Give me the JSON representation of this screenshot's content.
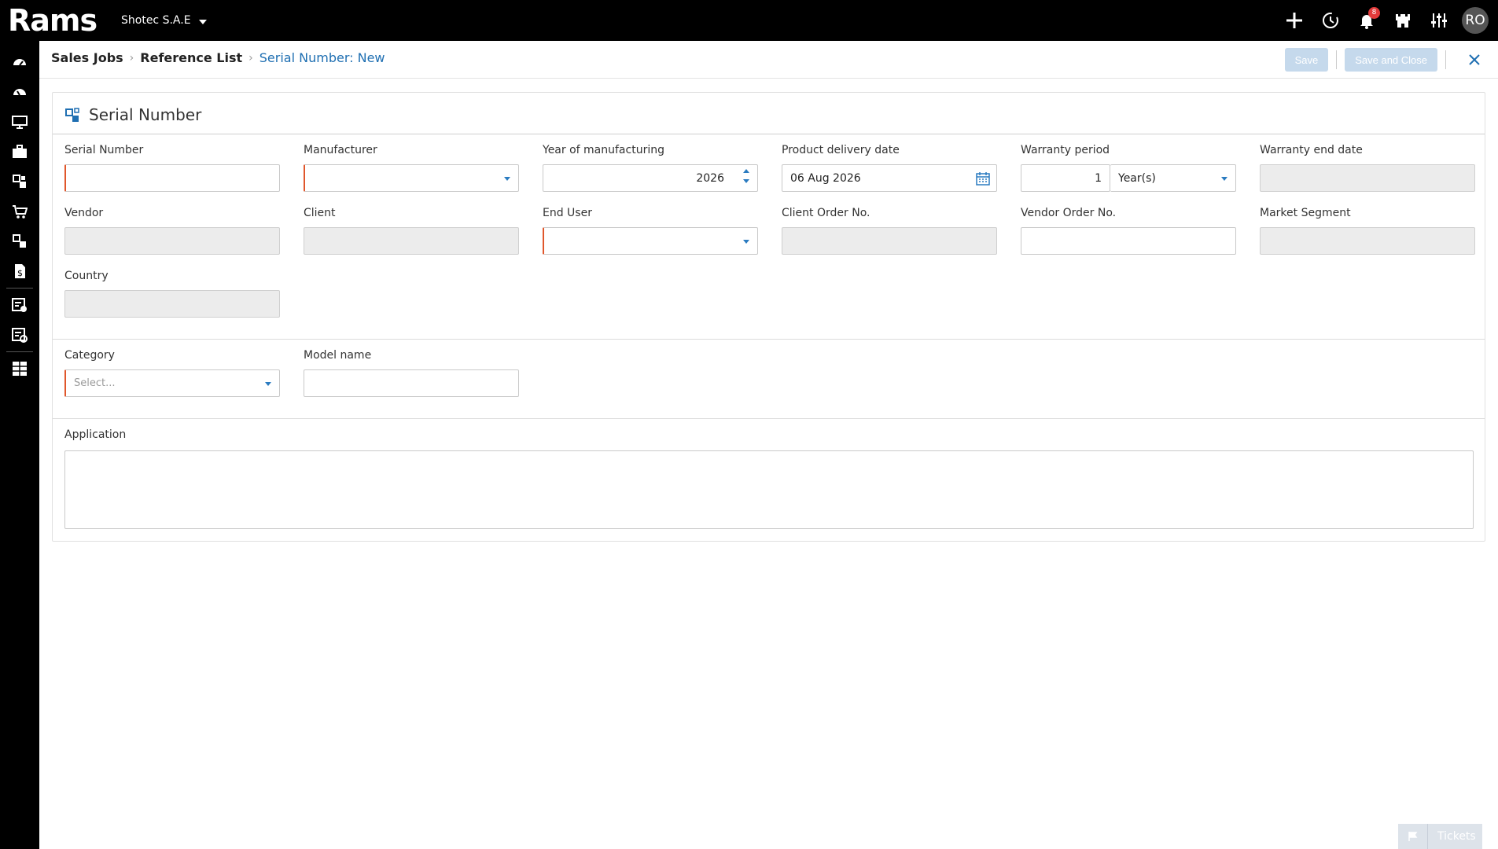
{
  "topbar": {
    "logo_text": "Rams",
    "company": "Shotec S.A.E",
    "notification_count": "8",
    "avatar": "RO",
    "icons": [
      "plus-icon",
      "history-icon",
      "bell-icon",
      "castle-icon",
      "sliders-icon"
    ]
  },
  "sidebar": {
    "items": [
      "dashboard-icon",
      "dashboard-alt-icon",
      "monitor-icon",
      "briefcase-icon",
      "serial-icon",
      "cart-icon",
      "module-icon",
      "invoice-icon",
      "checklist-icon",
      "settings-doc-icon",
      "grid-icon"
    ]
  },
  "breadcrumb": {
    "items": [
      "Sales Jobs",
      "Reference List"
    ],
    "current": "Serial Number: New"
  },
  "actions": {
    "save": "Save",
    "save_close": "Save and Close"
  },
  "form": {
    "title": "Serial Number",
    "fields": {
      "serial_number": {
        "label": "Serial Number",
        "value": ""
      },
      "manufacturer": {
        "label": "Manufacturer",
        "value": ""
      },
      "year": {
        "label": "Year of manufacturing",
        "value": "2026"
      },
      "delivery": {
        "label": "Product delivery date",
        "value": "06 Aug 2026"
      },
      "warranty": {
        "label": "Warranty period",
        "value": "1",
        "unit": "Year(s)"
      },
      "warranty_end": {
        "label": "Warranty end date",
        "value": ""
      },
      "vendor": {
        "label": "Vendor",
        "value": ""
      },
      "client": {
        "label": "Client",
        "value": ""
      },
      "end_user": {
        "label": "End User",
        "value": ""
      },
      "client_order": {
        "label": "Client Order No.",
        "value": ""
      },
      "vendor_order": {
        "label": "Vendor Order No.",
        "value": ""
      },
      "market_segment": {
        "label": "Market Segment",
        "value": ""
      },
      "country": {
        "label": "Country",
        "value": ""
      },
      "category": {
        "label": "Category",
        "placeholder": "Select..."
      },
      "model_name": {
        "label": "Model name",
        "value": ""
      },
      "application": {
        "label": "Application",
        "value": ""
      }
    }
  },
  "tickets": {
    "label": "Tickets"
  },
  "colors": {
    "accent": "#1f6fb2",
    "required": "#e0572c",
    "topbar": "#000000",
    "button_disabled": "#c5d9ec"
  }
}
